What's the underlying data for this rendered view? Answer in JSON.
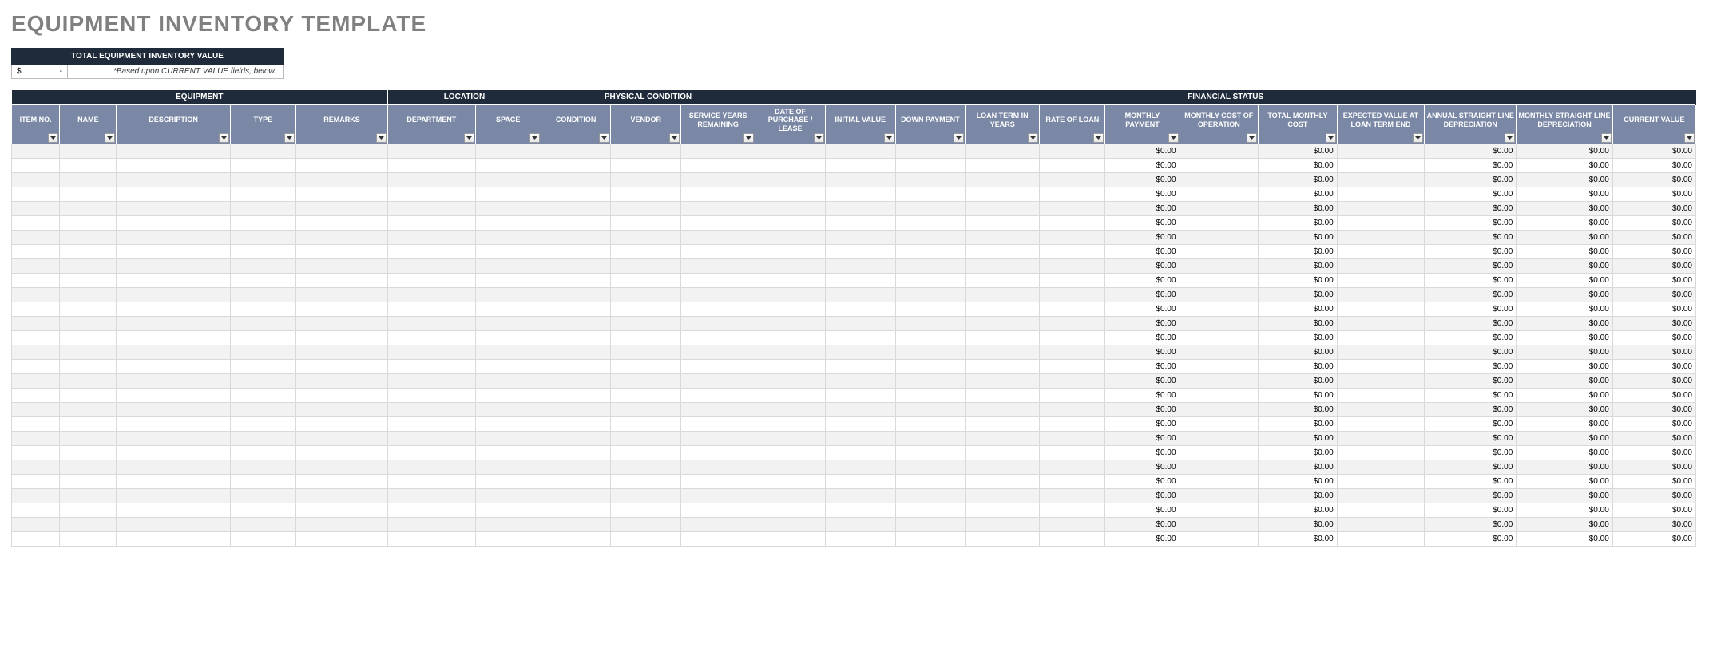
{
  "title": "EQUIPMENT INVENTORY TEMPLATE",
  "summary": {
    "header": "TOTAL EQUIPMENT INVENTORY VALUE",
    "dollar": "$",
    "dash": "-",
    "note": "*Based upon CURRENT VALUE fields, below."
  },
  "groups": [
    {
      "label": "EQUIPMENT",
      "span": 5
    },
    {
      "label": "LOCATION",
      "span": 2
    },
    {
      "label": "PHYSICAL CONDITION",
      "span": 3
    },
    {
      "label": "FINANCIAL STATUS",
      "span": 12
    }
  ],
  "columns": [
    "ITEM NO.",
    "NAME",
    "DESCRIPTION",
    "TYPE",
    "REMARKS",
    "DEPARTMENT",
    "SPACE",
    "CONDITION",
    "VENDOR",
    "SERVICE YEARS REMAINING",
    "DATE OF PURCHASE / LEASE",
    "INITIAL VALUE",
    "DOWN PAYMENT",
    "LOAN TERM IN YEARS",
    "RATE OF LOAN",
    "MONTHLY PAYMENT",
    "MONTHLY COST OF OPERATION",
    "TOTAL MONTHLY COST",
    "EXPECTED VALUE AT LOAN TERM END",
    "ANNUAL STRAIGHT LINE DEPRECIATION",
    "MONTHLY STRAIGHT LINE DEPRECIATION",
    "CURRENT VALUE"
  ],
  "zero": "$0.00",
  "row_count": 28,
  "value_columns": [
    15,
    17,
    19,
    20,
    21
  ]
}
